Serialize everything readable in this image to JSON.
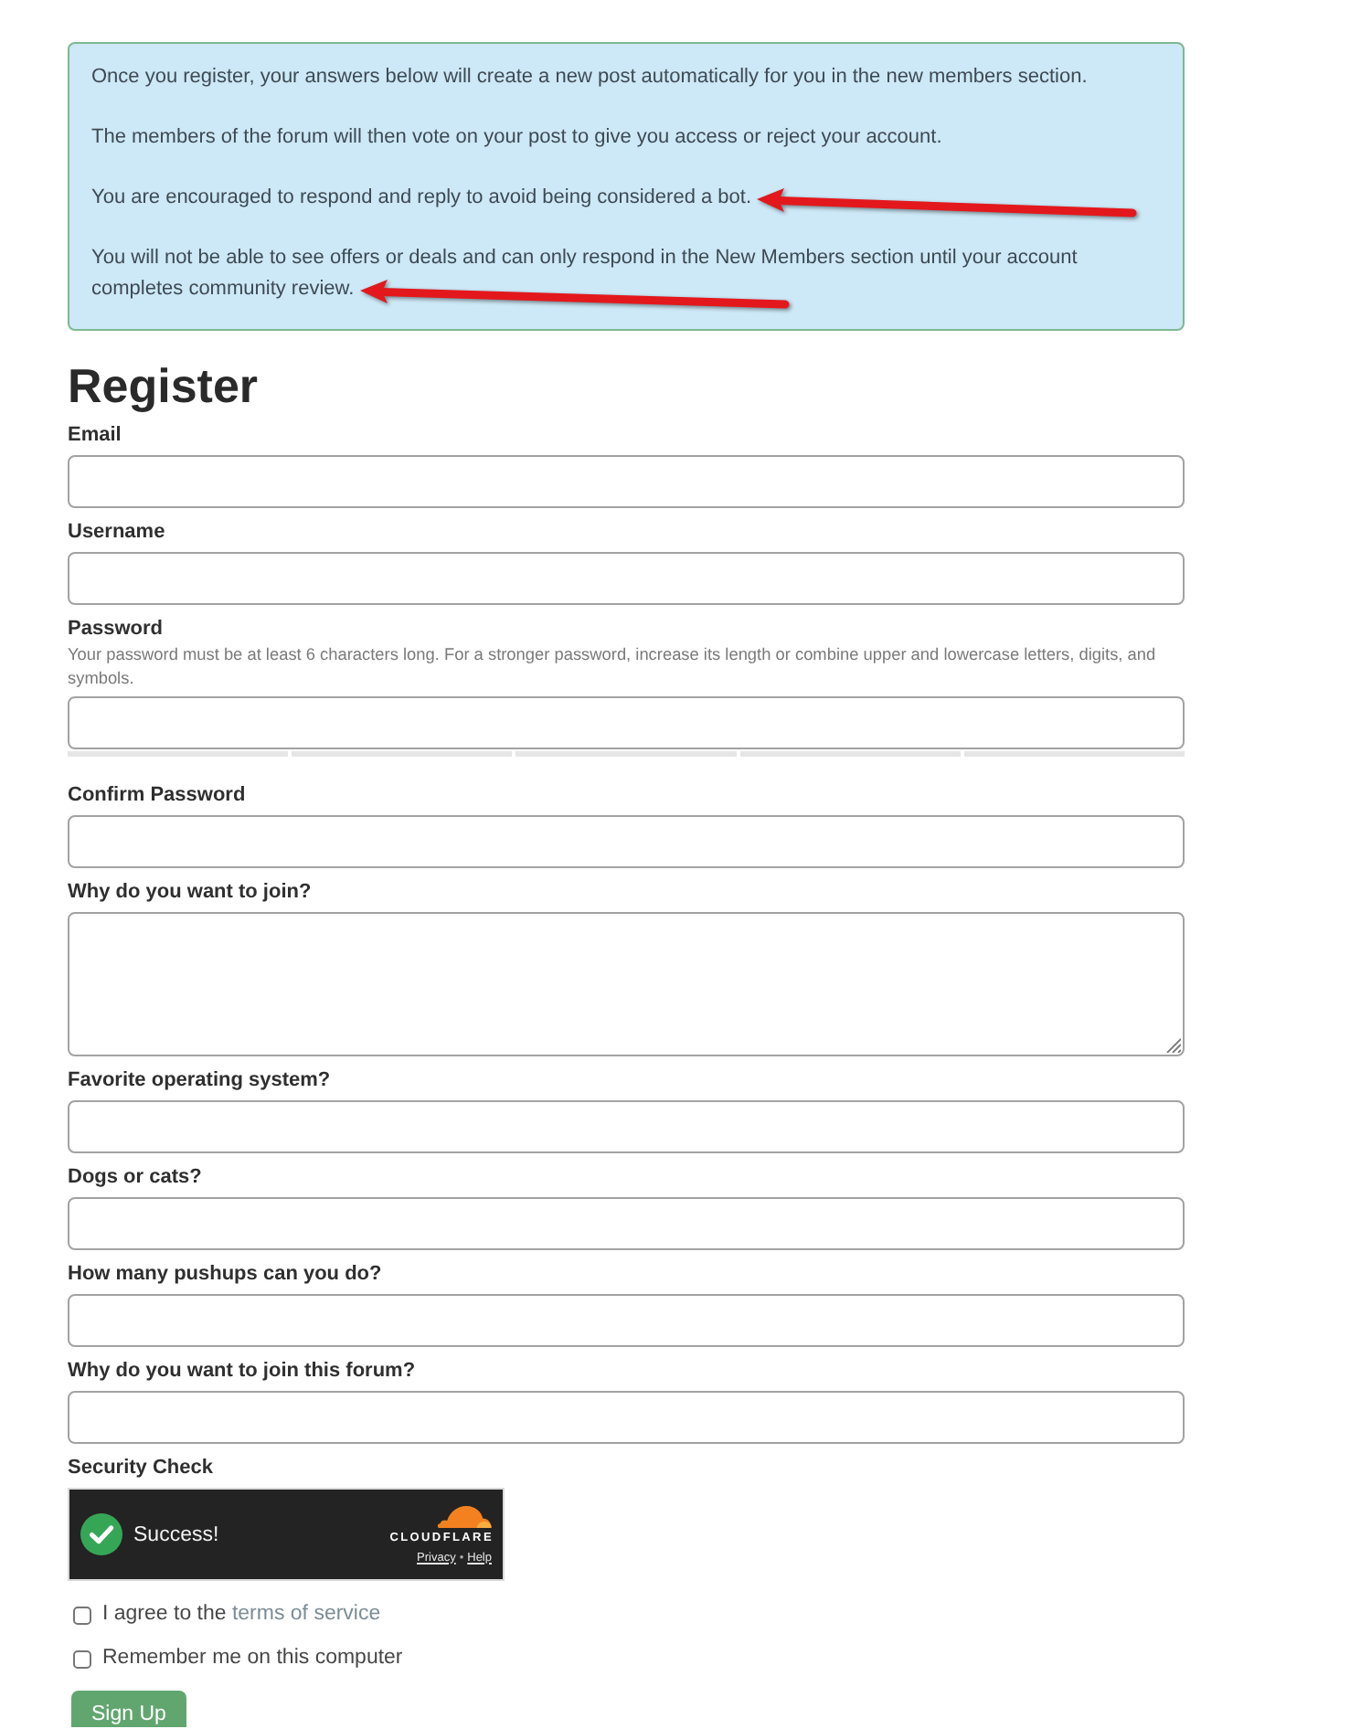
{
  "notice": {
    "paragraphs": [
      {
        "text": "Once you register, your answers below will create a new post automatically for you in the new members section.",
        "arrow": false
      },
      {
        "text": "The members of the forum will then vote on your post to give you access or reject your account.",
        "arrow": false
      },
      {
        "text": "You are encouraged to respond and reply to avoid being considered a bot.",
        "arrow": true
      },
      {
        "text": "You will not be able to see offers or deals and can only respond in the New Members section until your account completes community review.",
        "arrow": true
      }
    ]
  },
  "form": {
    "title": "Register",
    "fields": [
      {
        "kind": "input",
        "label": "Email"
      },
      {
        "kind": "input",
        "label": "Username"
      },
      {
        "kind": "password",
        "label": "Password",
        "hint": "Your password must be at least 6 characters long. For a stronger password, increase its length or combine upper and lowercase letters, digits, and symbols."
      },
      {
        "kind": "input",
        "label": "Confirm Password"
      },
      {
        "kind": "textarea",
        "label": "Why do you want to join?"
      },
      {
        "kind": "input",
        "label": "Favorite operating system?"
      },
      {
        "kind": "input",
        "label": "Dogs or cats?"
      },
      {
        "kind": "input",
        "label": "How many pushups can you do?"
      },
      {
        "kind": "input",
        "label": "Why do you want to join this forum?"
      }
    ],
    "security_check": {
      "label": "Security Check",
      "widget": {
        "status": "Success!",
        "brand": "CLOUDFLARE",
        "links": [
          "Privacy",
          "Help"
        ],
        "separator": "•"
      }
    },
    "options": [
      {
        "label": "I agree to the ",
        "link": "terms of service",
        "checked": false
      },
      {
        "label": "Remember me on this computer",
        "checked": false
      }
    ],
    "submit": "Sign Up"
  }
}
